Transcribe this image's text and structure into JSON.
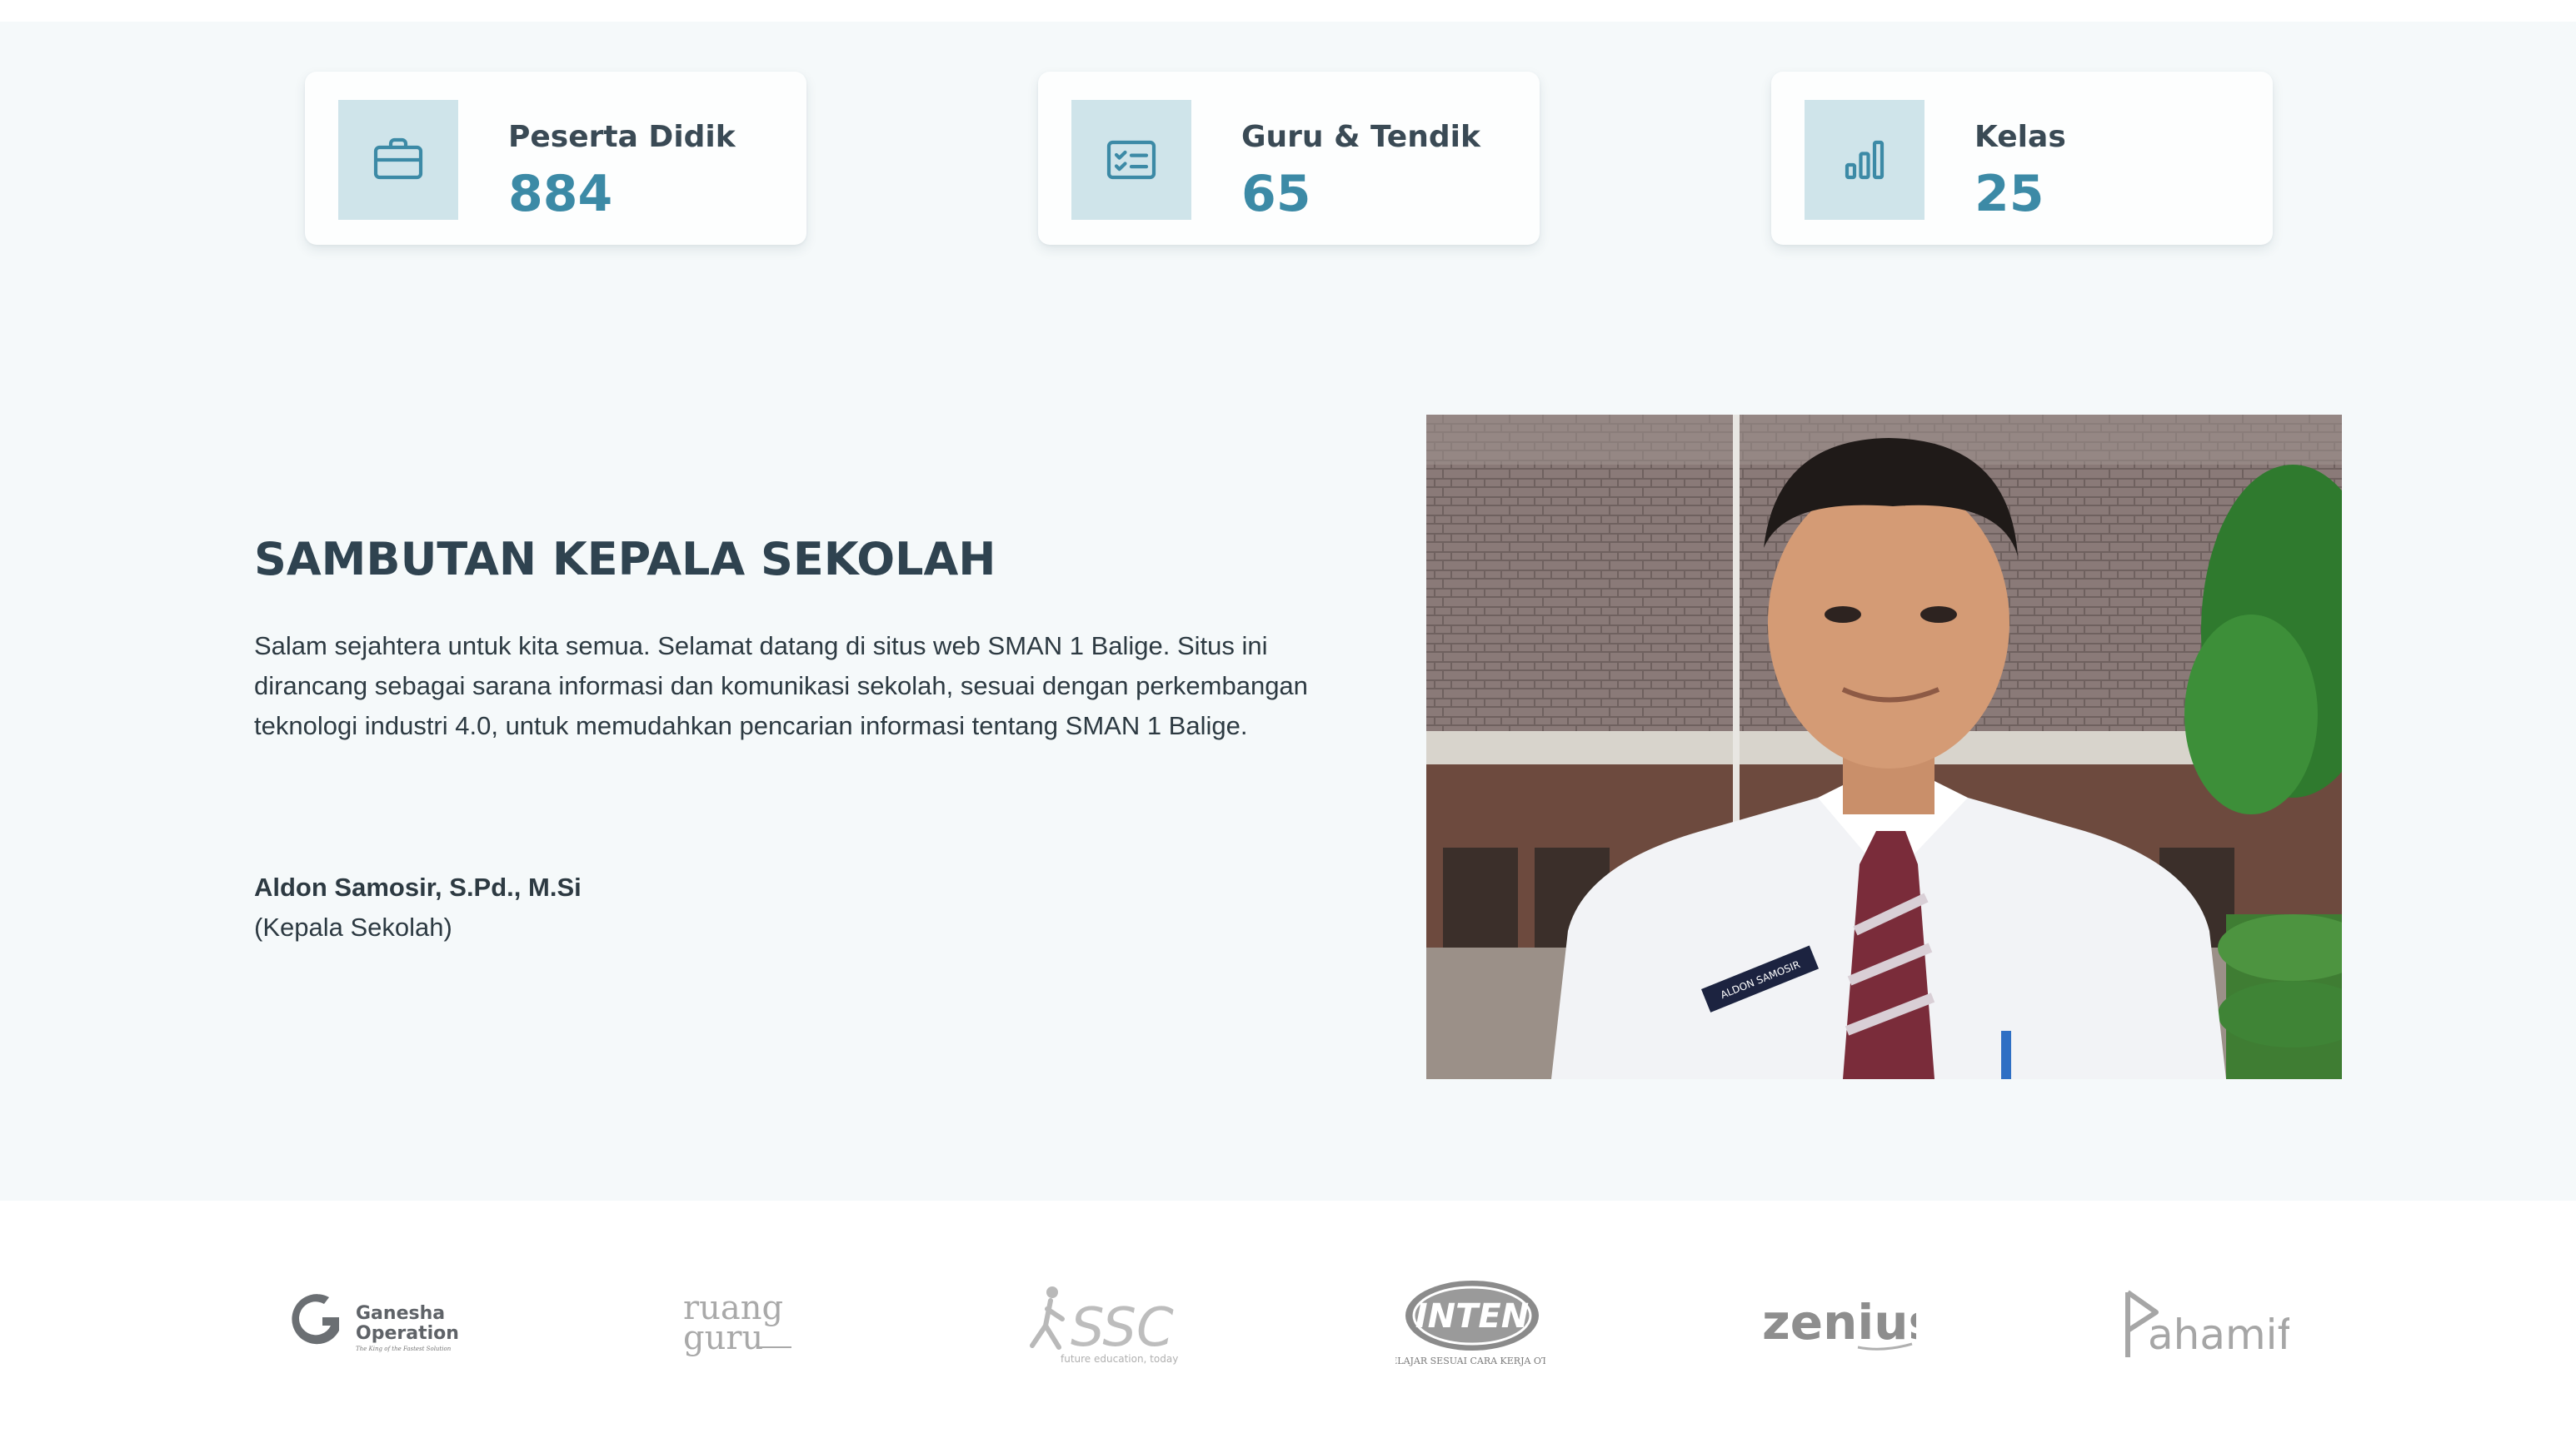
{
  "stats": [
    {
      "label": "Peserta Didik",
      "value": "884",
      "icon": "briefcase-icon"
    },
    {
      "label": "Guru & Tendik",
      "value": "65",
      "icon": "checklist-card-icon"
    },
    {
      "label": "Kelas",
      "value": "25",
      "icon": "bar-chart-icon"
    }
  ],
  "welcome": {
    "title": "SAMBUTAN KEPALA SEKOLAH",
    "text": "Salam sejahtera untuk kita semua. Selamat datang di situs web SMAN 1 Balige. Situs ini dirancang sebagai sarana informasi dan komunikasi sekolah, sesuai dengan perkembangan teknologi industri 4.0, untuk memudahkan pencarian informasi tentang SMAN 1 Balige.",
    "name": "Aldon Samosir, S.Pd., M.Si",
    "role": "(Kepala Sekolah)",
    "photo_badge": "ALDON SAMOSIR"
  },
  "partners": [
    {
      "name": "ganesha-operation",
      "line1": "Ganesha",
      "line2": "Operation",
      "tagline": "The King of the Fastest Solution"
    },
    {
      "name": "ruangguru",
      "line1": "ruang",
      "line2": "guru"
    },
    {
      "name": "ssc",
      "text": "SSC",
      "tagline": "future education, today"
    },
    {
      "name": "inten",
      "text": "INTEN",
      "tagline": "BELAJAR SESUAI CARA KERJA OTAK"
    },
    {
      "name": "zenius",
      "text": "zenius"
    },
    {
      "name": "pahamify",
      "text": "ahamify"
    }
  ],
  "colors": {
    "accent": "#3c8aa6",
    "icon_bg": "#cfe4ea",
    "section_bg": "#f5f9fa",
    "title": "#2f4350"
  }
}
